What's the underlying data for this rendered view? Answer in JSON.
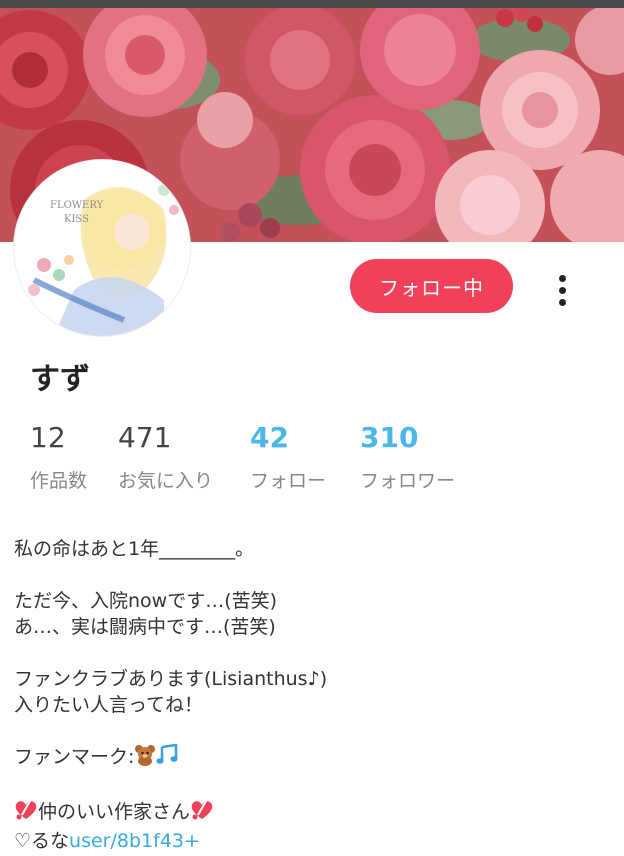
{
  "profile": {
    "name": "すず",
    "follow_label": "フォロー中",
    "avatar_text": "FLOWERY KISS"
  },
  "stats": [
    {
      "value": "12",
      "label": "作品数",
      "highlight": false
    },
    {
      "value": "471",
      "label": "お気に入り",
      "highlight": false
    },
    {
      "value": "42",
      "label": "フォロー",
      "highlight": true
    },
    {
      "value": "310",
      "label": "フォロワー",
      "highlight": true
    }
  ],
  "bio": {
    "line1": "私の命はあと1年________。",
    "line2": "ただ今、入院nowです…(苦笑)",
    "line3": "あ…、実は闘病中です…(苦笑)",
    "line4": "ファンクラブあります(Lisianthus♪)",
    "line5": "入りたい人言ってね！",
    "line6": "ファンマーク:",
    "line7": "仲のいい作家さん",
    "line8_prefix": "♡るな",
    "line8_link": "user/8b1f43+"
  },
  "colors": {
    "accent": "#f0405a",
    "link": "#4ab7e8"
  },
  "icons": {
    "fanmark": [
      "teddy-bear-icon",
      "music-notes-icon"
    ],
    "friends": "heart-exclamation-icon"
  }
}
